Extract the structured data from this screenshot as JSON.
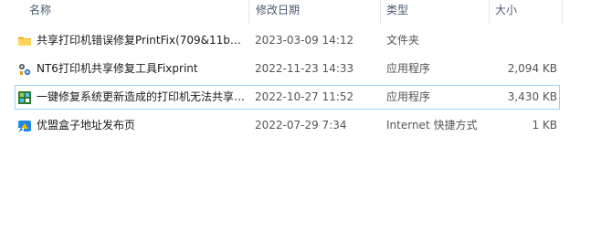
{
  "columns": {
    "name": "名称",
    "date": "修改日期",
    "type": "类型",
    "size": "大小"
  },
  "files": [
    {
      "name": "共享打印机错误修复PrintFix(709&11b…",
      "date": "2023-03-09 14:12",
      "type": "文件夹",
      "size": "",
      "icon": "folder-icon"
    },
    {
      "name": "NT6打印机共享修复工具Fixprint",
      "date": "2022-11-23 14:33",
      "type": "应用程序",
      "size": "2,094 KB",
      "icon": "app-gear-icon"
    },
    {
      "name": "一键修复系统更新造成的打印机无法共享…",
      "date": "2022-10-27 11:52",
      "type": "应用程序",
      "size": "3,430 KB",
      "icon": "app-installer-icon"
    },
    {
      "name": "优盟盒子地址发布页",
      "date": "2022-07-29 7:34",
      "type": "Internet 快捷方式",
      "size": "1 KB",
      "icon": "internet-shortcut-icon"
    }
  ]
}
